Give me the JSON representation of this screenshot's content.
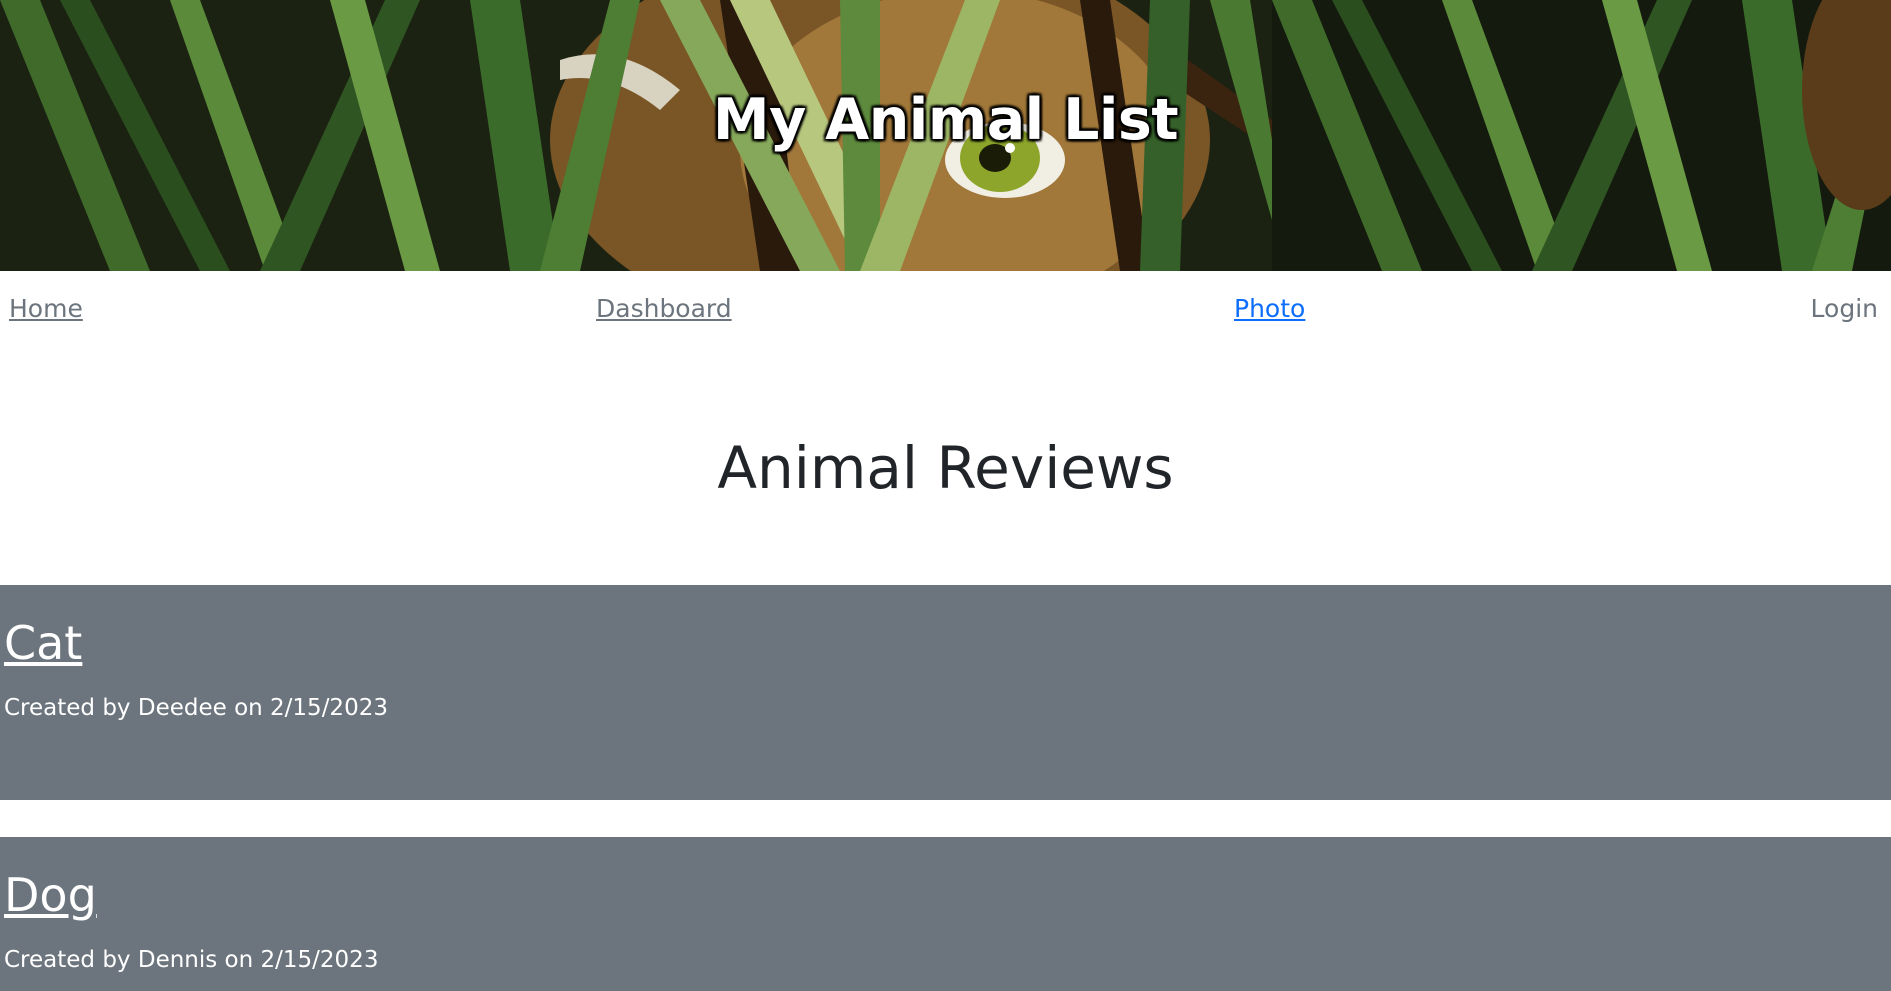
{
  "site": {
    "title": "My Animal List"
  },
  "nav": {
    "home": "Home",
    "dashboard": "Dashboard",
    "photo": "Photo",
    "login": "Login"
  },
  "main": {
    "heading": "Animal Reviews",
    "reviews": [
      {
        "animal": "Cat",
        "meta": "Created by Deedee on 2/15/2023"
      },
      {
        "animal": "Dog",
        "meta": "Created by Dennis on 2/15/2023"
      }
    ]
  },
  "colors": {
    "card_bg": "#6c757d",
    "link_active": "#0d6efd",
    "link_muted": "#6c757d",
    "heading": "#212529"
  },
  "icons": {
    "banner": "tiger-eye-in-grass-image"
  }
}
